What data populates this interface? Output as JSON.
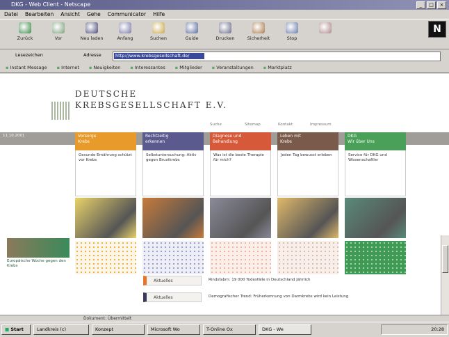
{
  "window": {
    "title": "DKG - Web Client - Netscape"
  },
  "menu": [
    "Datei",
    "Bearbeiten",
    "Ansicht",
    "Gehe",
    "Communicator",
    "Hilfe"
  ],
  "toolbar": [
    {
      "label": "Zurück",
      "icon": "back-arrow-icon",
      "color": "#3a8a4a"
    },
    {
      "label": "Vor",
      "icon": "forward-arrow-icon",
      "color": "#7aa07a"
    },
    {
      "label": "Neu laden",
      "icon": "reload-icon",
      "color": "#4a4a7a"
    },
    {
      "label": "Anfang",
      "icon": "home-icon",
      "color": "#7a7aa8"
    },
    {
      "label": "Suchen",
      "icon": "search-icon",
      "color": "#c8a84a"
    },
    {
      "label": "Guide",
      "icon": "guide-icon",
      "color": "#5a6a9a"
    },
    {
      "label": "Drucken",
      "icon": "print-icon",
      "color": "#6a6a8a"
    },
    {
      "label": "Sicherheit",
      "icon": "lock-icon",
      "color": "#a87a4a"
    },
    {
      "label": "Stop",
      "icon": "stop-icon",
      "color": "#6a7aa8"
    },
    {
      "label": "",
      "icon": "extra-icon",
      "color": "#aa8888"
    }
  ],
  "location": {
    "bookmarks_label": "Lesezeichen",
    "address_label": "Adresse",
    "url": "http://www.krebsgesellschaft.de/"
  },
  "personal_toolbar": [
    "Instant Message",
    "Internet",
    "Neuigkeiten",
    "Interessantes",
    "Mitglieder",
    "Veranstaltungen",
    "Marktplatz"
  ],
  "site": {
    "logo_line1": "DEUTSCHE",
    "logo_line2": "KREBSGESELLSCHAFT E.V.",
    "toplinks": [
      "Suche",
      "Sitemap",
      "Kontakt",
      "Impressum"
    ],
    "strip_left": "11.10.2001",
    "columns": [
      {
        "title": "Vorsorge / Krebs",
        "desc": "Gesunde Ernährung schützt vor Krebs",
        "color": "#e89a2a",
        "img": "food-image",
        "pat": "dots1",
        "imgcolor": "#e8d26a"
      },
      {
        "title": "Rechtzeitig / erkennen",
        "desc": "Selbstuntersuchung: Aktiv gegen Brustkrebs",
        "color": "#5b5a8e",
        "img": "portrait-image",
        "pat": "dots2",
        "imgcolor": "#c87a3a"
      },
      {
        "title": "Diagnose und / Behandlung",
        "desc": "Was ist die beste Therapie für mich?",
        "color": "#d65a3a",
        "img": "doctor-image",
        "pat": "dots3",
        "imgcolor": "#8a8a9a"
      },
      {
        "title": "Leben mit / Krebs",
        "desc": "Jeden Tag bewusst erleben",
        "color": "#7a5a4a",
        "img": "landscape-image",
        "pat": "dots4",
        "imgcolor": "#e0b86a"
      },
      {
        "title": "DKG / Wir über Uns",
        "desc": "Service für DKG und Wissenschaftler",
        "color": "#4aa058",
        "img": "cell-image",
        "pat": "dots5",
        "imgcolor": "#5a8a7a"
      }
    ],
    "sidebox_caption": "Europäische Woche gegen den Krebs",
    "news": [
      {
        "label": "Aktuelles",
        "text": "Rindsfabrn: 19 000 Todesfälle in Deutschland jährlich",
        "color": "#e8742a"
      },
      {
        "label": "Aktuelles",
        "text": "Demografischer Trend: Früherkennung von Darmkrebs wird kein Leistung",
        "color": "#3a3a5a"
      }
    ]
  },
  "status": {
    "text": "Dokument: Übermittelt"
  },
  "taskbar": {
    "start": "Start",
    "items": [
      "Landkreis (c)",
      "Konzept",
      "Microsoft Wo",
      "T-Online Ox",
      "DKG - We"
    ],
    "time": "20:28"
  }
}
